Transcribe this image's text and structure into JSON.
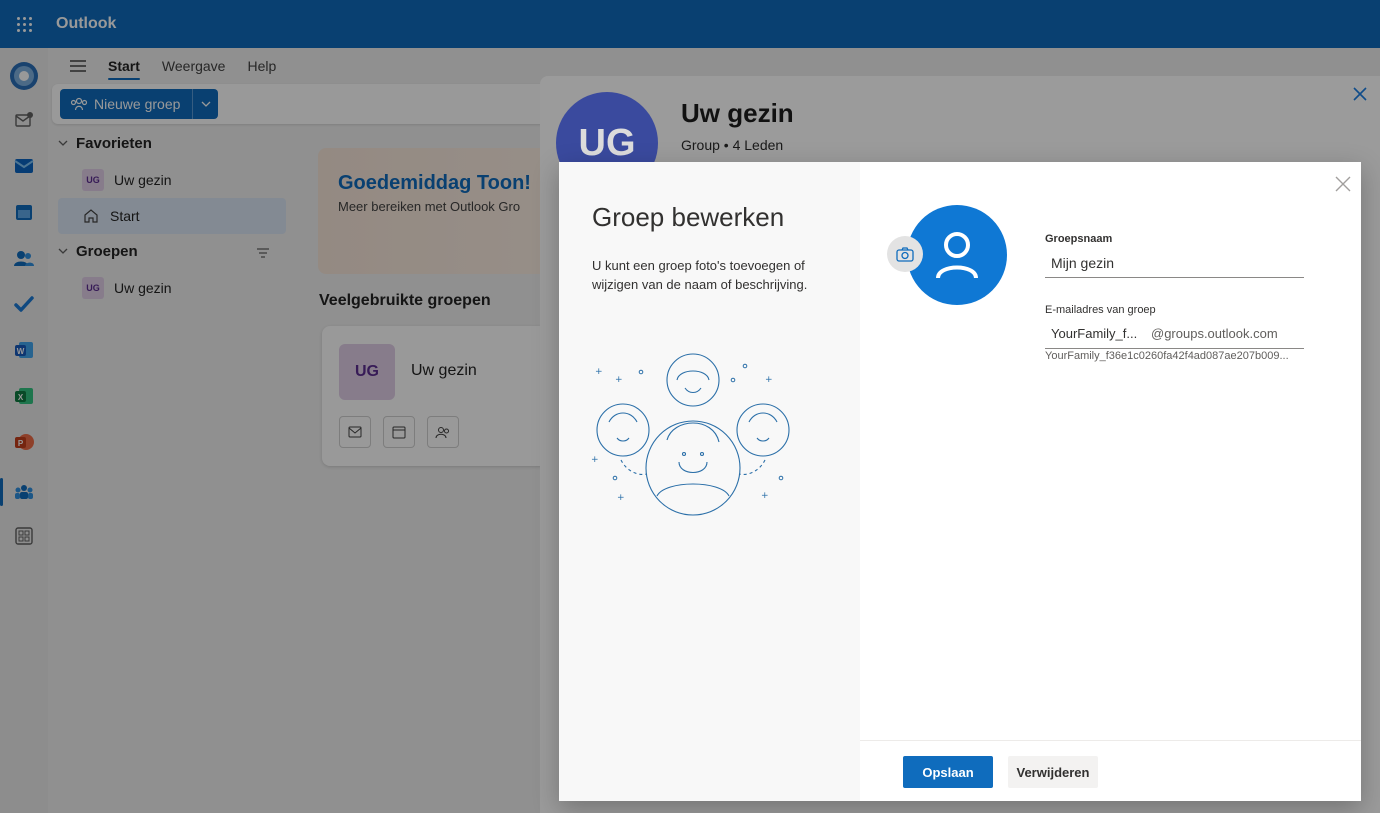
{
  "app": {
    "title": "Outlook"
  },
  "ribbon": {
    "tabs": [
      {
        "label": "Start"
      },
      {
        "label": "Weergave"
      },
      {
        "label": "Help"
      }
    ],
    "new_group_label": "Nieuwe groep"
  },
  "nav": {
    "favorites_label": "Favorieten",
    "favorites": [
      {
        "initials": "UG",
        "label": "Uw gezin"
      }
    ],
    "start_label": "Start",
    "groups_label": "Groepen",
    "groups": [
      {
        "initials": "UG",
        "label": "Uw gezin"
      }
    ]
  },
  "main": {
    "greeting": "Goedemiddag Toon!",
    "greeting_sub": "Meer bereiken met Outlook Gro",
    "frequent_title": "Veelgebruikte groepen",
    "card": {
      "initials": "UG",
      "name": "Uw gezin"
    }
  },
  "group_panel": {
    "initials": "UG",
    "title": "Uw gezin",
    "subtitle": "Group • 4 Leden"
  },
  "dialog": {
    "title": "Groep bewerken",
    "description": "U kunt een groep foto's toevoegen of wijzigen van de naam of beschrijving.",
    "name_label": "Groepsnaam",
    "name_value": "Mijn gezin",
    "email_label": "E-mailadres van groep",
    "email_value": "YourFamily_f...",
    "email_domain": "@groups.outlook.com",
    "email_full": "YourFamily_f36e1c0260fa42f4ad087ae207b009...",
    "save_label": "Opslaan",
    "delete_label": "Verwijderen"
  },
  "colors": {
    "brand": "#0f6cbd",
    "avatar_blue": "#0f78d4"
  }
}
